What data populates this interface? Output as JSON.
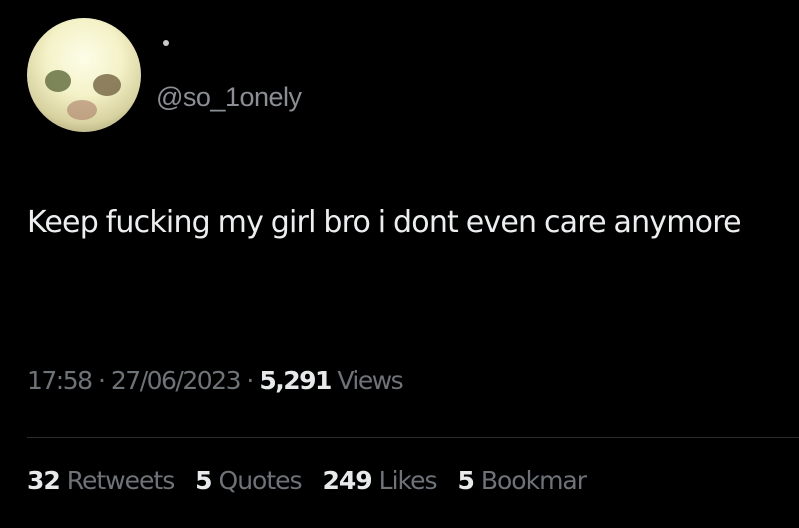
{
  "tweet": {
    "handle": "@so_1onely",
    "text": "Keep fucking my girl bro i dont even care anymore",
    "time": "17:58",
    "separator": " · ",
    "date": "27/06/2023",
    "views_count": "5,291",
    "views_label": "Views",
    "stats": {
      "retweets_count": "32",
      "retweets_label": "Retweets",
      "quotes_count": "5",
      "quotes_label": "Quotes",
      "likes_count": "249",
      "likes_label": "Likes",
      "bookmarks_count": "5",
      "bookmarks_label": "Bookmar"
    }
  },
  "colors": {
    "background": "#000000",
    "text_primary": "#e7e9ea",
    "text_secondary": "#6e7378"
  }
}
